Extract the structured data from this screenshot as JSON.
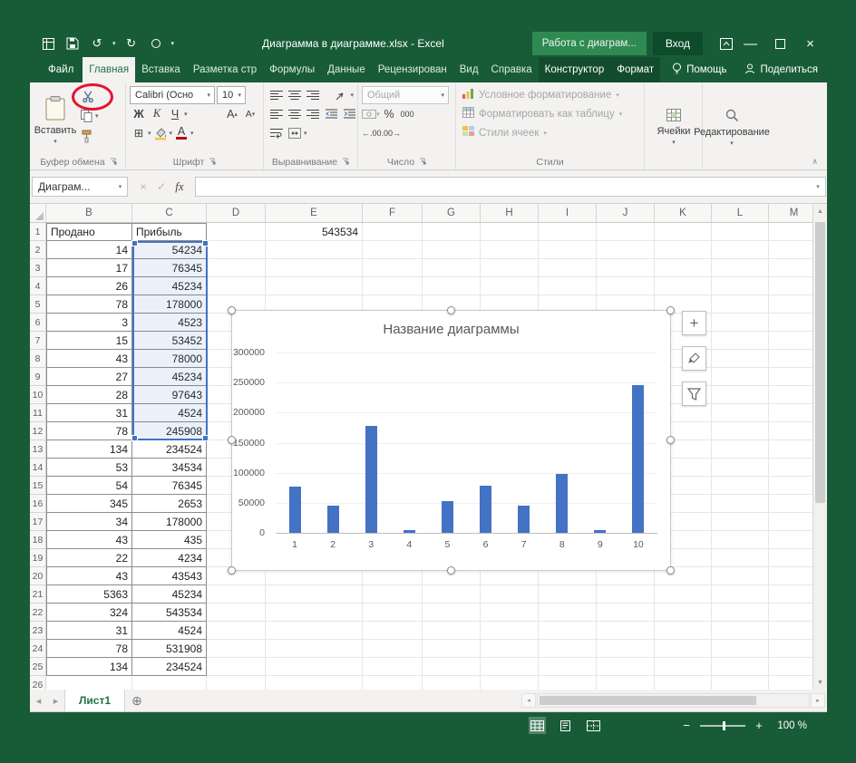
{
  "colors": {
    "titlebar_green": "#185C37",
    "accent_green": "#217346",
    "contextual_green": "#2F8A51",
    "bar_blue": "#4472C4",
    "selection_blue": "#4472C4",
    "annotation_red": "#E8112D"
  },
  "titlebar": {
    "title": "Диаграмма в диаграмме.xlsx - Excel",
    "contextual_group": "Работа с диаграм...",
    "sign_in_label": "Вход"
  },
  "ribbon_tabs": {
    "tabs": [
      {
        "label": "Файл",
        "state": "file"
      },
      {
        "label": "Главная",
        "state": "active"
      },
      {
        "label": "Вставка"
      },
      {
        "label": "Разметка стр"
      },
      {
        "label": "Формулы"
      },
      {
        "label": "Данные"
      },
      {
        "label": "Рецензирован"
      },
      {
        "label": "Вид"
      },
      {
        "label": "Справка"
      },
      {
        "label": "Конструктор",
        "state": "contextual"
      },
      {
        "label": "Формат",
        "state": "contextual"
      }
    ],
    "help_label": "Помощь",
    "share_label": "Поделиться"
  },
  "ribbon": {
    "clipboard": {
      "group_label": "Буфер обмена",
      "paste_label": "Вставить"
    },
    "font": {
      "group_label": "Шрифт",
      "font_name": "Calibri (Осно",
      "font_size": "10",
      "bold_label": "Ж",
      "italic_label": "К",
      "underline_label": "Ч",
      "grow_label": "А",
      "shrink_label": "А",
      "font_color_label": "А"
    },
    "alignment": {
      "group_label": "Выравнивание"
    },
    "number": {
      "group_label": "Число",
      "format_value": "Общий",
      "percent_label": "%",
      "thousands_label": "000",
      "inc_decimal_label": "←.00",
      "dec_decimal_label": ".00→"
    },
    "styles": {
      "group_label": "Стили",
      "items": [
        "Условное форматирование",
        "Форматировать как таблицу",
        "Стили ячеек"
      ]
    },
    "cells": {
      "label": "Ячейки"
    },
    "editing": {
      "label": "Редактирование"
    }
  },
  "formula_bar": {
    "name_box": "Диаграм...",
    "fx_label": "fx",
    "value": ""
  },
  "sheet": {
    "column_headers": [
      "B",
      "C",
      "D",
      "E",
      "F",
      "G",
      "H",
      "I",
      "J",
      "K",
      "L",
      "M"
    ],
    "selection": {
      "range": "C2:C12"
    },
    "rows": [
      {
        "n": "1",
        "cells": {
          "B": "Продано",
          "C": "Прибыль",
          "E": "543534"
        }
      },
      {
        "n": "2",
        "cells": {
          "B": "14",
          "C": "54234"
        }
      },
      {
        "n": "3",
        "cells": {
          "B": "17",
          "C": "76345"
        }
      },
      {
        "n": "4",
        "cells": {
          "B": "26",
          "C": "45234"
        }
      },
      {
        "n": "5",
        "cells": {
          "B": "78",
          "C": "178000"
        }
      },
      {
        "n": "6",
        "cells": {
          "B": "3",
          "C": "4523"
        }
      },
      {
        "n": "7",
        "cells": {
          "B": "15",
          "C": "53452"
        }
      },
      {
        "n": "8",
        "cells": {
          "B": "43",
          "C": "78000"
        }
      },
      {
        "n": "9",
        "cells": {
          "B": "27",
          "C": "45234"
        }
      },
      {
        "n": "10",
        "cells": {
          "B": "28",
          "C": "97643"
        }
      },
      {
        "n": "11",
        "cells": {
          "B": "31",
          "C": "4524"
        }
      },
      {
        "n": "12",
        "cells": {
          "B": "78",
          "C": "245908"
        }
      },
      {
        "n": "13",
        "cells": {
          "B": "134",
          "C": "234524"
        }
      },
      {
        "n": "14",
        "cells": {
          "B": "53",
          "C": "34534"
        }
      },
      {
        "n": "15",
        "cells": {
          "B": "54",
          "C": "76345"
        }
      },
      {
        "n": "16",
        "cells": {
          "B": "345",
          "C": "2653"
        }
      },
      {
        "n": "17",
        "cells": {
          "B": "34",
          "C": "178000"
        }
      },
      {
        "n": "18",
        "cells": {
          "B": "43",
          "C": "435"
        }
      },
      {
        "n": "19",
        "cells": {
          "B": "22",
          "C": "4234"
        }
      },
      {
        "n": "20",
        "cells": {
          "B": "43",
          "C": "43543"
        }
      },
      {
        "n": "21",
        "cells": {
          "B": "5363",
          "C": "45234"
        }
      },
      {
        "n": "22",
        "cells": {
          "B": "324",
          "C": "543534"
        }
      },
      {
        "n": "23",
        "cells": {
          "B": "31",
          "C": "4524"
        }
      },
      {
        "n": "24",
        "cells": {
          "B": "78",
          "C": "531908"
        }
      },
      {
        "n": "25",
        "cells": {
          "B": "134",
          "C": "234524"
        }
      },
      {
        "n": "26",
        "cells": {}
      }
    ]
  },
  "chart_data": {
    "type": "bar",
    "title": "Название диаграммы",
    "categories": [
      "1",
      "2",
      "3",
      "4",
      "5",
      "6",
      "7",
      "8",
      "9",
      "10"
    ],
    "values": [
      76345,
      45234,
      178000,
      4523,
      53452,
      78000,
      45234,
      97643,
      4524,
      245908
    ],
    "xlabel": "",
    "ylabel": "",
    "ylim": [
      0,
      300000
    ],
    "y_ticks": [
      0,
      50000,
      100000,
      150000,
      200000,
      250000,
      300000
    ],
    "bar_color": "#4472C4",
    "legend": "none",
    "gridlines": "light"
  },
  "sheet_tabs": {
    "active": "Лист1"
  },
  "status_bar": {
    "zoom_label": "100 %"
  },
  "annotation": {
    "shape": "ellipse",
    "color": "#E8112D",
    "target": "cut-button"
  }
}
